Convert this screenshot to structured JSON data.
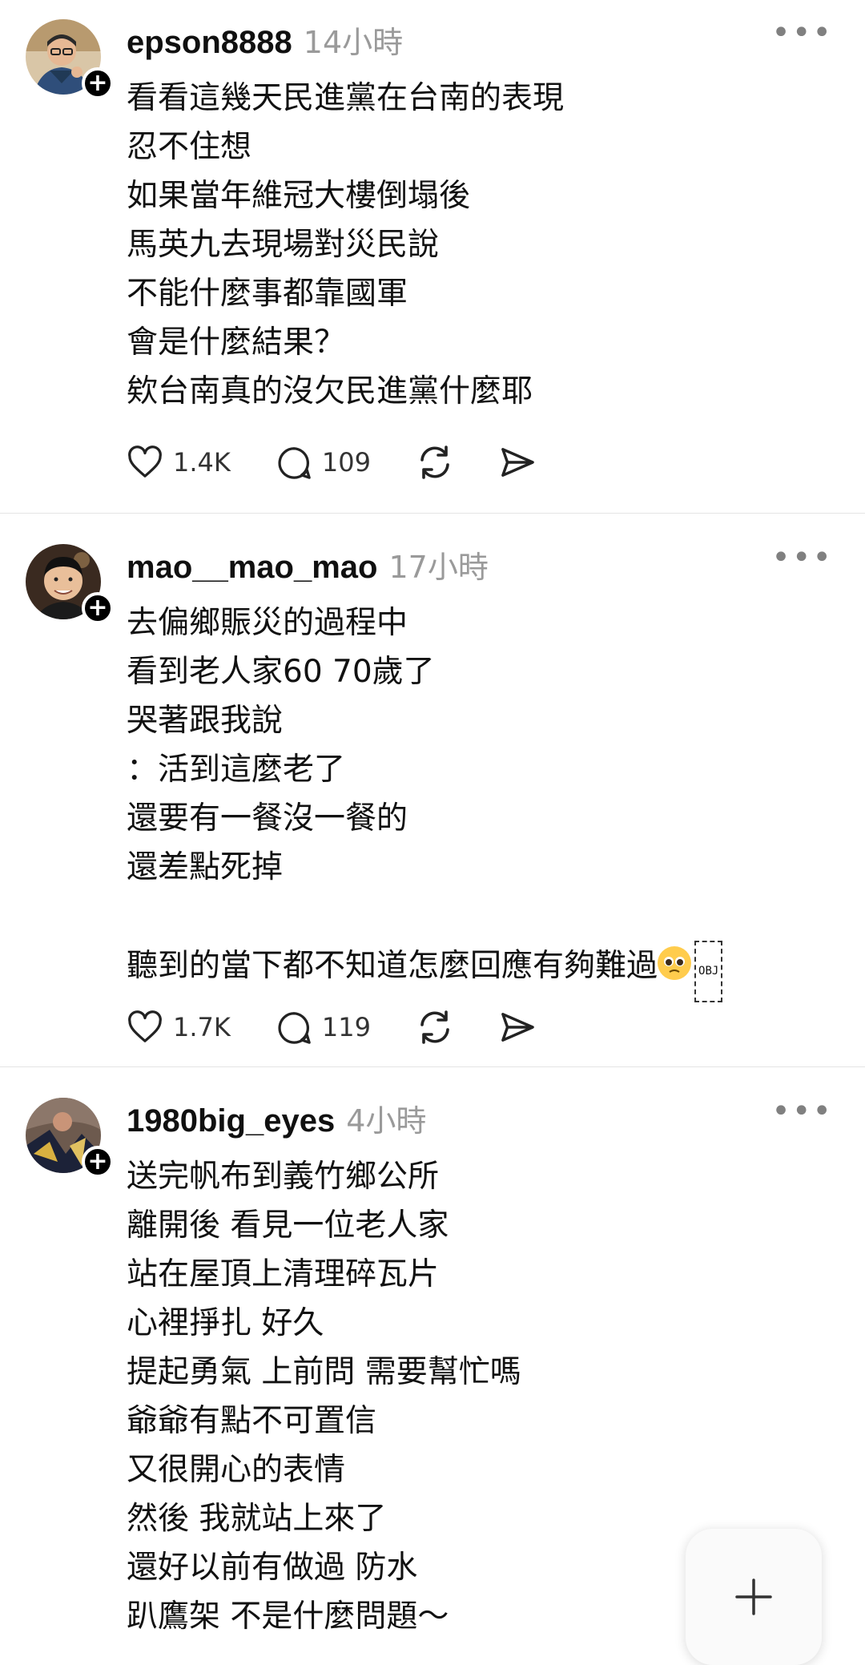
{
  "posts": [
    {
      "username": "epson8888",
      "time": "14小時",
      "lines": [
        "看看這幾天民進黨在台南的表現",
        "忍不住想",
        "如果當年維冠大樓倒塌後",
        "馬英九去現場對災民說",
        "不能什麼事都靠國軍",
        "會是什麼結果？",
        "欸台南真的沒欠民進黨什麼耶"
      ],
      "likes": "1.4K",
      "comments": "109"
    },
    {
      "username": "mao__mao_mao",
      "time": "17小時",
      "lines": [
        "去偏鄉賑災的過程中",
        "看到老人家60 70歲了",
        "哭著跟我說",
        "：活到這麼老了",
        "還要有一餐沒一餐的",
        "還差點死掉",
        "",
        "聽到的當下都不知道怎麼回應有夠難過"
      ],
      "last_line_suffix": "OBJ",
      "likes": "1.7K",
      "comments": "119"
    },
    {
      "username": "1980big_eyes",
      "time": "4小時",
      "lines": [
        "送完帆布到義竹鄉公所",
        "離開後 看見一位老人家",
        "站在屋頂上清理碎瓦片",
        "心裡掙扎 好久",
        "提起勇氣 上前問 需要幫忙嗎",
        "爺爺有點不可置信",
        "又很開心的表情",
        "然後 我就站上來了",
        "還好以前有做過 防水",
        "趴鷹架 不是什麼問題～"
      ]
    }
  ],
  "icons": {
    "more": "more-icon",
    "like": "heart-icon",
    "comment": "comment-icon",
    "repost": "repost-icon",
    "share": "send-icon",
    "fab": "plus-icon"
  }
}
